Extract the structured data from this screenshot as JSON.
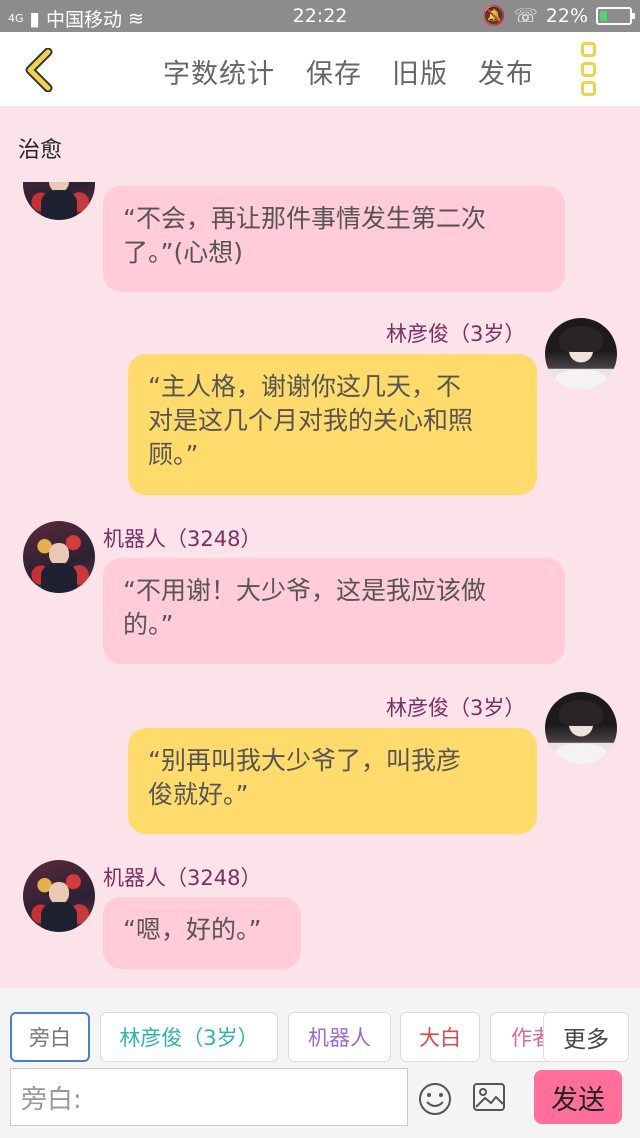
{
  "status": {
    "carrier": "中国移动",
    "network": "4G",
    "time": "22:22",
    "battery": "22%",
    "battery_level": 0.22
  },
  "toolbar": {
    "word_count": "字数统计",
    "save": "保存",
    "old_version": "旧版",
    "publish": "发布"
  },
  "chapter_title": "治愈",
  "messages": [
    {
      "speaker": "",
      "text_lines": [
        "“不会，再让那件事情发生第二次",
        "了。”(心想)"
      ]
    },
    {
      "speaker": "林彦俊（3岁）",
      "text_lines": [
        "“主人格，谢谢你这几天，不",
        "对是这几个月对我的关心和照",
        "顾。”"
      ]
    },
    {
      "speaker": "机器人（3248）",
      "text_lines": [
        "“不用谢！大少爷，这是我应该做",
        "的。”"
      ]
    },
    {
      "speaker": "林彦俊（3岁）",
      "text_lines": [
        "“别再叫我大少爷了，叫我彦",
        "俊就好。”"
      ]
    },
    {
      "speaker": "机器人（3248）",
      "text_lines": [
        "“嗯，好的。”"
      ]
    }
  ],
  "roles": [
    {
      "label": "旁白",
      "color": "#777777"
    },
    {
      "label": "林彦俊（3岁）",
      "color": "#2bb5a8"
    },
    {
      "label": "机器人",
      "color": "#9b6bd0"
    },
    {
      "label": "大白",
      "color": "#e04747"
    },
    {
      "label": "作者",
      "color": "#d86a9a"
    },
    {
      "label": "更多",
      "color": "#444444"
    }
  ],
  "input": {
    "placeholder": "旁白:"
  },
  "send_label": "发送",
  "colors": {
    "background": "#fbe3e9",
    "pink_bubble": "#ffccd8",
    "yellow_bubble": "#fedb6a",
    "send": "#ff6f99",
    "accent": "#f2d24a"
  }
}
